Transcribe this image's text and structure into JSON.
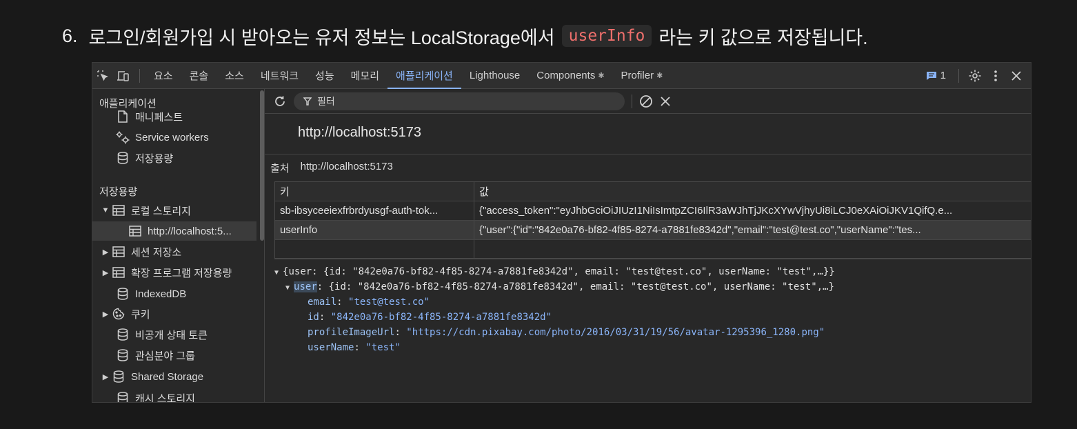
{
  "heading": {
    "number": "6.",
    "text_before": "로그인/회원가입 시 받아오는 유저 정보는 LocalStorage에서",
    "code": "userInfo",
    "text_after": "라는 키 값으로 저장됩니다."
  },
  "toolbar": {
    "tabs": [
      "요소",
      "콘솔",
      "소스",
      "네트워크",
      "성능",
      "메모리",
      "애플리케이션",
      "Lighthouse",
      "Components",
      "Profiler"
    ],
    "active_tab": "애플리케이션",
    "issues_count": "1"
  },
  "sidebar": {
    "application_heading": "애플리케이션",
    "app_items": [
      "매니페스트",
      "Service workers",
      "저장용량"
    ],
    "storage_heading": "저장용량",
    "local_storage": "로컬 스토리지",
    "local_storage_child": "http://localhost:5...",
    "session_storage": "세션 저장소",
    "extension_storage": "확장 프로그램 저장용량",
    "indexeddb": "IndexedDB",
    "cookies": "쿠키",
    "private_state_tokens": "비공개 상태 토큰",
    "interest_groups": "관심분야 그룹",
    "shared_storage": "Shared Storage",
    "cache_storage_partial": "캐시 스토리지"
  },
  "filter": {
    "placeholder": "필터"
  },
  "origin": {
    "title": "http://localhost:5173",
    "label": "출처",
    "value": "http://localhost:5173"
  },
  "table": {
    "key_header": "키",
    "value_header": "값",
    "rows": [
      {
        "key": "sb-ibsyceeiexfrbrdyusgf-auth-tok...",
        "value": "{\"access_token\":\"eyJhbGciOiJIUzI1NiIsImtpZCI6IlR3aWJhTjJKcXYwVjhyUi8iLCJ0eXAiOiJKV1QifQ.e..."
      },
      {
        "key": "userInfo",
        "value": "{\"user\":{\"id\":\"842e0a76-bf82-4f85-8274-a7881fe8342d\",\"email\":\"test@test.co\",\"userName\":\"tes..."
      }
    ]
  },
  "preview": {
    "root_summary": "{user: {id: \"842e0a76-bf82-4f85-8274-a7881fe8342d\", email: \"test@test.co\", userName: \"test\",…}}",
    "user_key": "user",
    "user_summary": ": {id: \"842e0a76-bf82-4f85-8274-a7881fe8342d\", email: \"test@test.co\", userName: \"test\",…}",
    "fields": [
      {
        "key": "email",
        "value": "\"test@test.co\""
      },
      {
        "key": "id",
        "value": "\"842e0a76-bf82-4f85-8274-a7881fe8342d\""
      },
      {
        "key": "profileImageUrl",
        "value": "\"https://cdn.pixabay.com/photo/2016/03/31/19/56/avatar-1295396_1280.png\""
      },
      {
        "key": "userName",
        "value": "\"test\""
      }
    ]
  }
}
